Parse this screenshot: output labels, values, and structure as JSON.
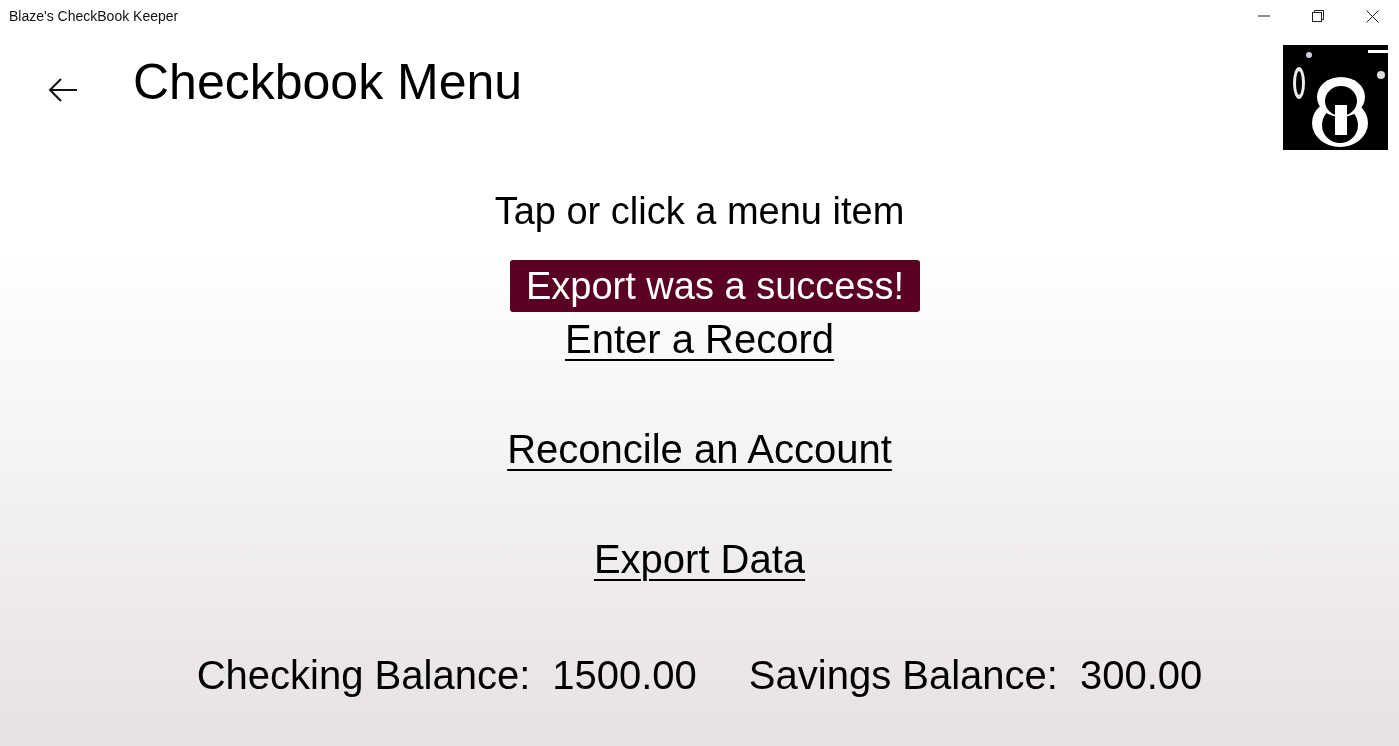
{
  "window": {
    "title": "Blaze's CheckBook Keeper"
  },
  "header": {
    "title": "Checkbook Menu"
  },
  "instruction": "Tap or click a menu item",
  "menu_items": [
    "Enter a Record",
    "Reconcile an Account",
    "Export Data"
  ],
  "toast": "Export was a success!",
  "balances": [
    {
      "label": "Checking Balance:",
      "value": "1500.00"
    },
    {
      "label": "Savings Balance:",
      "value": "300.00"
    }
  ]
}
